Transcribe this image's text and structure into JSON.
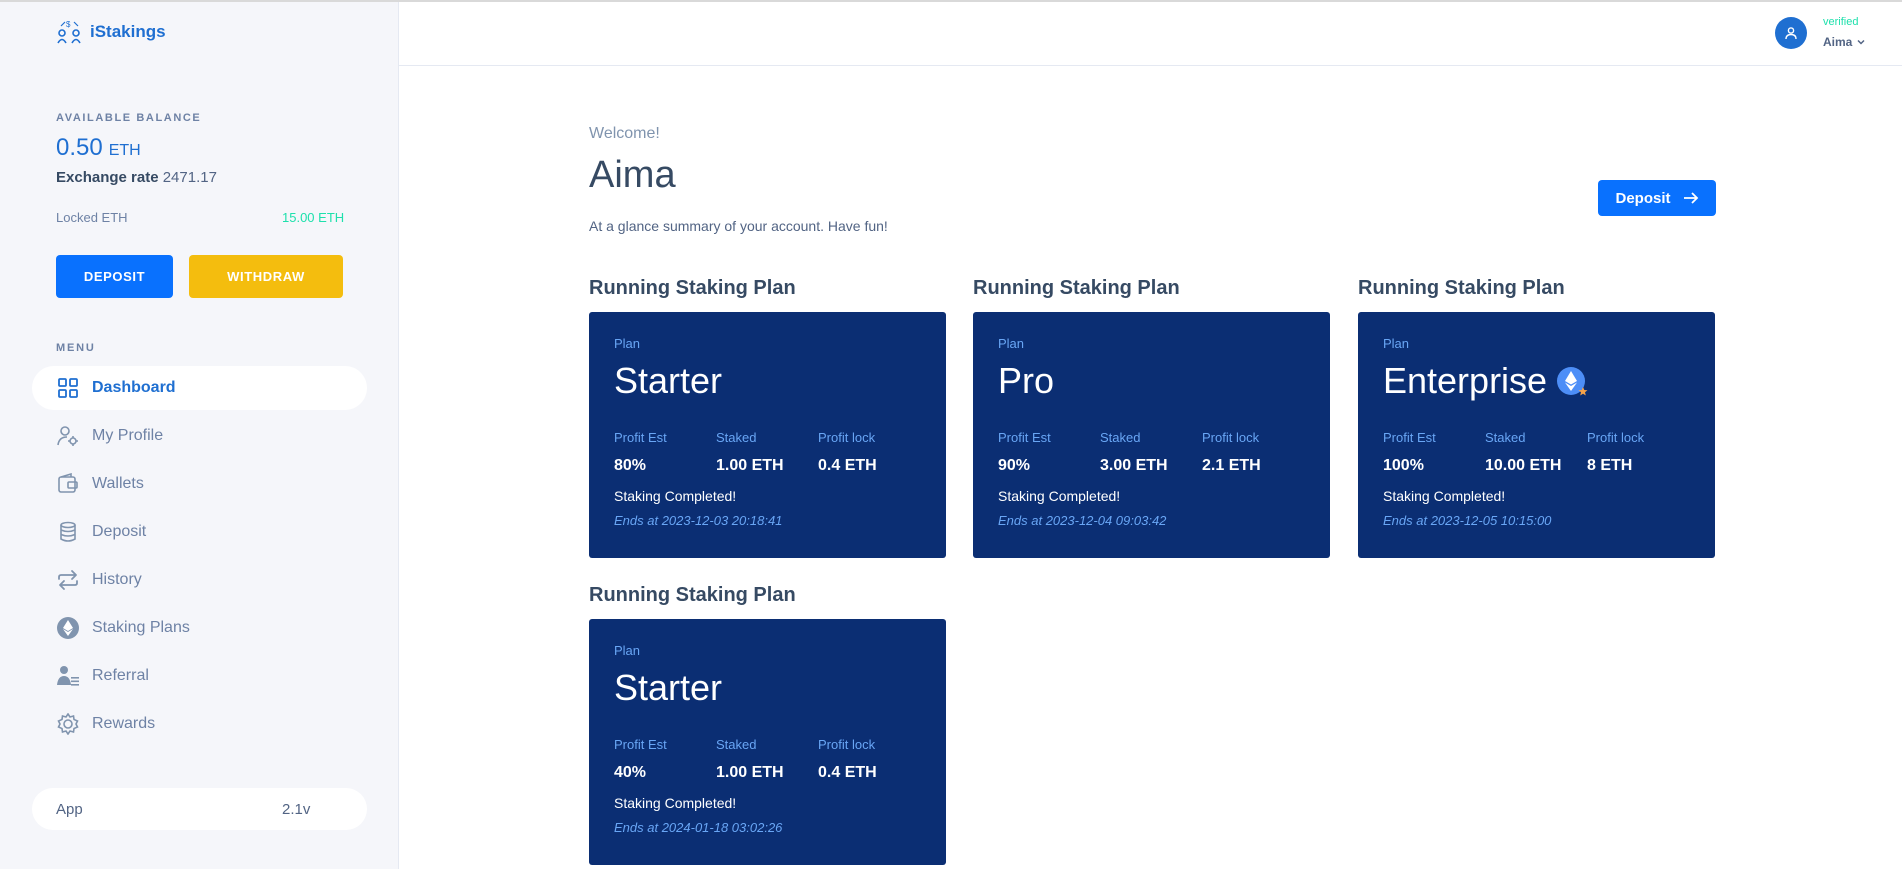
{
  "brand": {
    "name": "iStakings"
  },
  "sidebar": {
    "balance_label": "AVAILABLE BALANCE",
    "balance_value": "0.50",
    "balance_currency": "ETH",
    "exchange_label": "Exchange rate",
    "exchange_value": "2471.17",
    "locked_label": "Locked ETH",
    "locked_value": "15.00 ETH",
    "deposit_btn": "DEPOSIT",
    "withdraw_btn": "WITHDRAW",
    "menu_label": "MENU",
    "items": [
      {
        "label": "Dashboard",
        "icon": "dashboard-icon",
        "active": true
      },
      {
        "label": "My Profile",
        "icon": "user-gear-icon"
      },
      {
        "label": "Wallets",
        "icon": "wallet-icon"
      },
      {
        "label": "Deposit",
        "icon": "coins-icon"
      },
      {
        "label": "History",
        "icon": "repeat-icon"
      },
      {
        "label": "Staking Plans",
        "icon": "ethereum-icon"
      },
      {
        "label": "Referral",
        "icon": "user-list-icon"
      },
      {
        "label": "Rewards",
        "icon": "gear-badge-icon"
      }
    ],
    "app_label": "App",
    "app_version": "2.1v"
  },
  "header": {
    "status": "verified",
    "username": "Aima"
  },
  "main": {
    "welcome": "Welcome!",
    "title": "Aima",
    "subtitle": "At a glance summary of your account. Have fun!",
    "deposit_btn": "Deposit",
    "cards": [
      {
        "heading": "Running Staking Plan",
        "plan_label": "Plan",
        "plan": "Starter",
        "profit_label": "Profit Est",
        "profit": "80%",
        "staked_label": "Staked",
        "staked": "1.00 ETH",
        "lock_label": "Profit lock",
        "lock": "0.4 ETH",
        "status": "Staking Completed!",
        "ends": "Ends at 2023-12-03 20:18:41"
      },
      {
        "heading": "Running Staking Plan",
        "plan_label": "Plan",
        "plan": "Pro",
        "profit_label": "Profit Est",
        "profit": "90%",
        "staked_label": "Staked",
        "staked": "3.00 ETH",
        "lock_label": "Profit lock",
        "lock": "2.1 ETH",
        "status": "Staking Completed!",
        "ends": "Ends at 2023-12-04 09:03:42"
      },
      {
        "heading": "Running Staking Plan",
        "plan_label": "Plan",
        "plan": "Enterprise",
        "profit_label": "Profit Est",
        "profit": "100%",
        "staked_label": "Staked",
        "staked": "10.00 ETH",
        "lock_label": "Profit lock",
        "lock": "8 ETH",
        "status": "Staking Completed!",
        "ends": "Ends at 2023-12-05 10:15:00"
      },
      {
        "heading": "Running Staking Plan",
        "plan_label": "Plan",
        "plan": "Starter",
        "profit_label": "Profit Est",
        "profit": "40%",
        "staked_label": "Staked",
        "staked": "1.00 ETH",
        "lock_label": "Profit lock",
        "lock": "0.4 ETH",
        "status": "Staking Completed!",
        "ends": "Ends at 2024-01-18 03:02:26"
      }
    ]
  },
  "colors": {
    "primary": "#0971fe",
    "warning": "#f4bd0e",
    "success": "#1ee0ac",
    "card_bg": "#0b2e73",
    "card_label": "#69a6f5"
  }
}
